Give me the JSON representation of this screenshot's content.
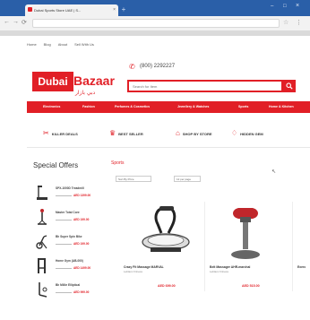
{
  "browser": {
    "tab_title": "Dubai Sports Store UAE | S...",
    "tab_close": "×",
    "new_tab": "+",
    "window_controls": {
      "minimize": "–",
      "maximize": "□",
      "close": "×"
    },
    "nav_back": "←",
    "nav_forward": "→",
    "nav_reload": "⟳",
    "star": "☆",
    "menu": "⋮"
  },
  "top_links": [
    "Home",
    "Blog",
    "About",
    "Sell With Us"
  ],
  "header": {
    "logo_box": "Dubai",
    "logo_word": "Bazaar",
    "logo_arabic": "دبي بازار",
    "phone": "(800) 2292227",
    "search_placeholder": "Search for Item",
    "brand_color": "#e11f26"
  },
  "nav_menu": [
    "Electronics",
    "Fashion",
    "Perfumes & Cosmetics",
    "Jewellery & Watches",
    "Sports",
    "Home & Kitchen"
  ],
  "promo_bar": [
    {
      "label": "KILLER DEALS",
      "icon": "tag-icon"
    },
    {
      "label": "BEST SELLER",
      "icon": "bestseller-icon"
    },
    {
      "label": "SHOP BY STORE",
      "icon": "store-icon"
    },
    {
      "label": "HIDDEN GEM",
      "icon": "gem-icon"
    }
  ],
  "special_offers": {
    "title": "Special Offers",
    "items": [
      {
        "name": "SPX-1000D Treadmill",
        "price": "AED 1399.00"
      },
      {
        "name": "Master Total Core",
        "price": "AED 199.00"
      },
      {
        "name": "Bh Super Spin Bike",
        "price": "AED 199.00"
      },
      {
        "name": "Home Gym (AB-000)",
        "price": "AED 1499.00"
      },
      {
        "name": "Bh Millie Elliptical",
        "price": "AED 999.00"
      }
    ]
  },
  "sports": {
    "title": "Sports",
    "sort_label": "Sort By Price",
    "per_page_label": "12 per page",
    "products": [
      {
        "name": "Crazy Fit Massage MARVAL",
        "brand": "Leblanc Fitness",
        "price": "AED 699.00"
      },
      {
        "name": "Belt Massager AHR-marchal",
        "brand": "Leblanc Fitness",
        "price": "AED 515.00"
      },
      {
        "name": "Exerc",
        "brand": "",
        "price": ""
      }
    ]
  }
}
